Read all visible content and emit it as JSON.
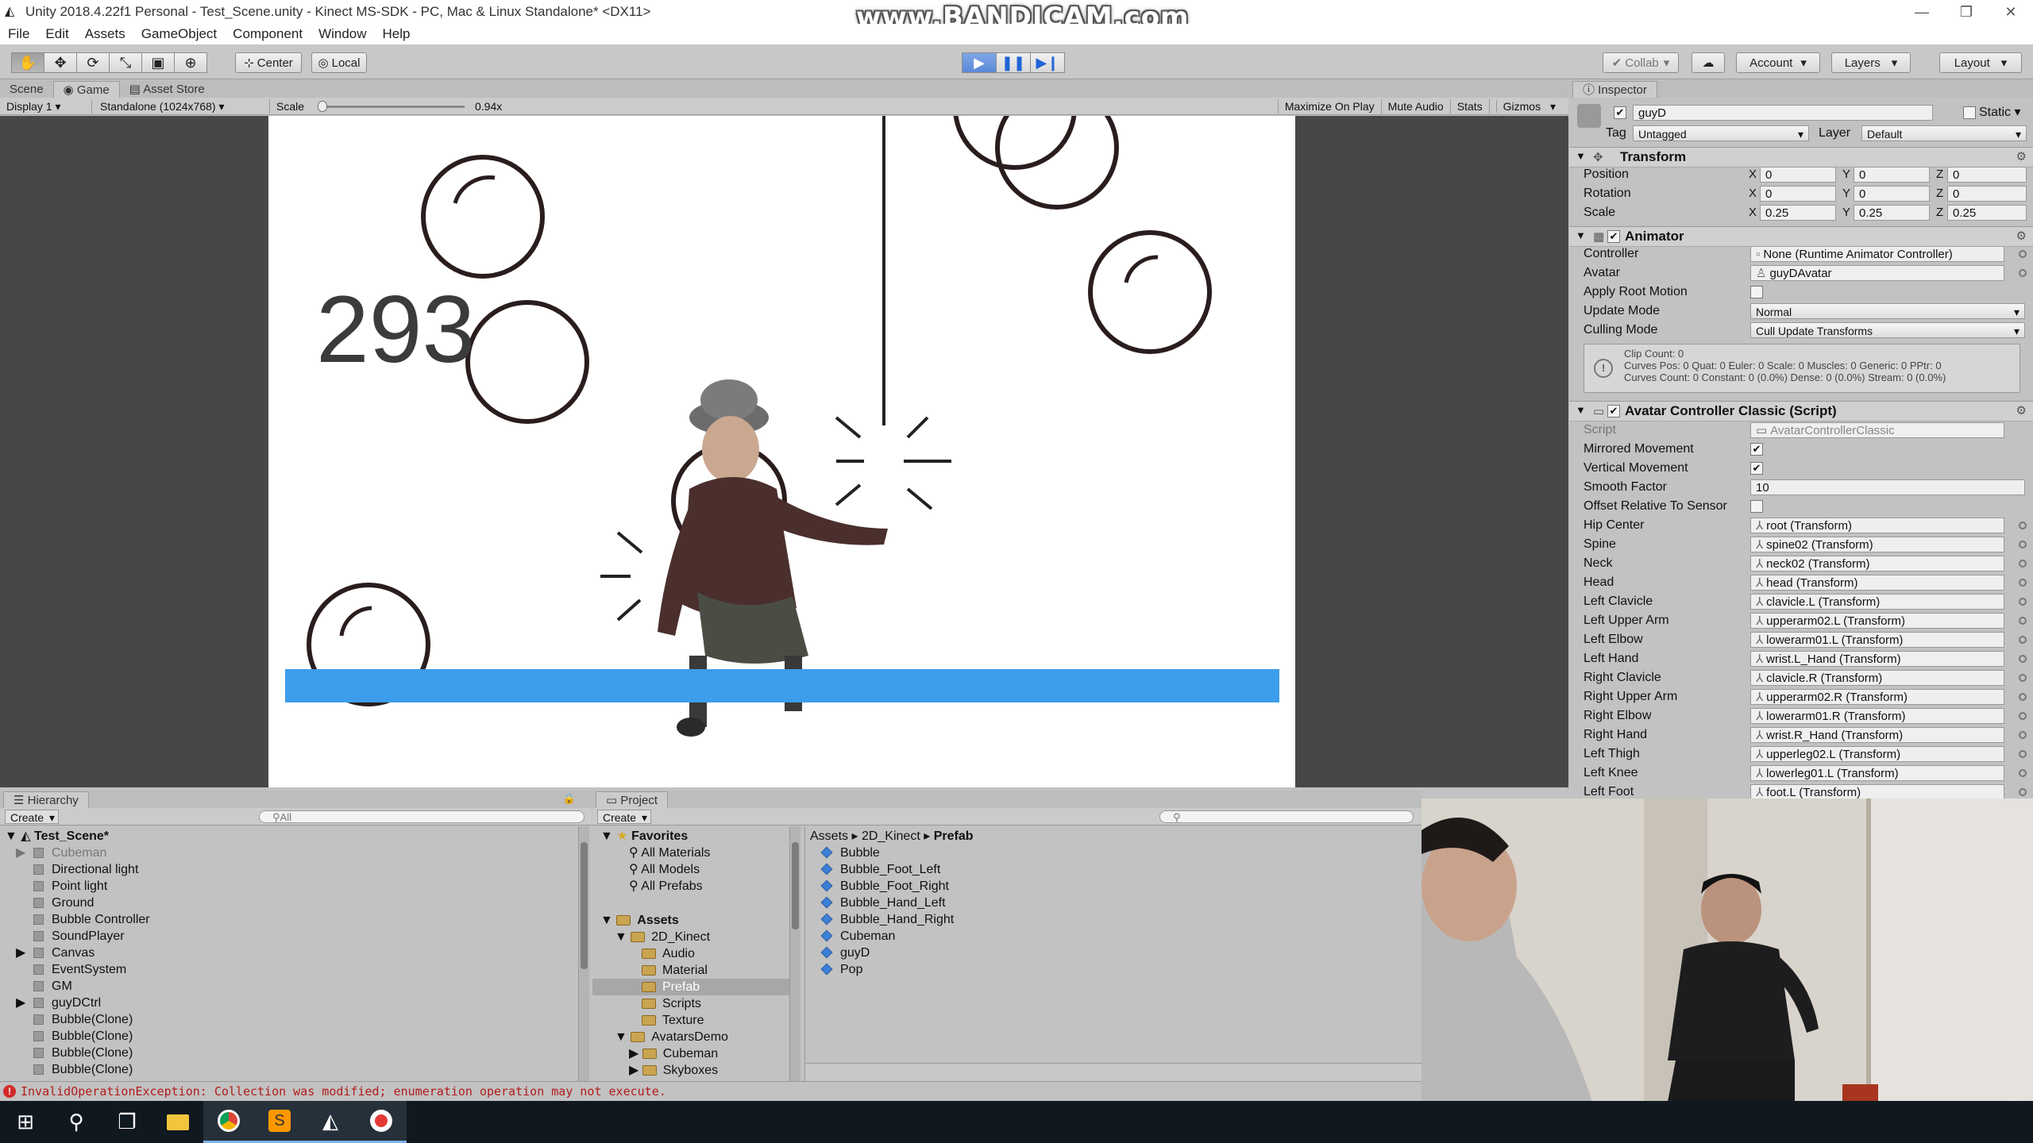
{
  "window": {
    "title": "Unity 2018.4.22f1 Personal - Test_Scene.unity - Kinect MS-SDK - PC, Mac & Linux Standalone* <DX11>",
    "watermark": "www.BANDICAM.com"
  },
  "menu": [
    "File",
    "Edit",
    "Assets",
    "GameObject",
    "Component",
    "Window",
    "Help"
  ],
  "toolbar": {
    "pivot": "Center",
    "space": "Local",
    "collab": "Collab",
    "account": "Account",
    "layers": "Layers",
    "layout": "Layout"
  },
  "game_view": {
    "tabs": [
      "Scene",
      "Game",
      "Asset Store"
    ],
    "display": "Display 1",
    "resolution": "Standalone (1024x768)",
    "scale_label": "Scale",
    "scale_value": "0.94",
    "options": [
      "Maximize On Play",
      "Mute Audio",
      "Stats",
      "Gizmos"
    ],
    "score": "293"
  },
  "inspector": {
    "tab": "Inspector",
    "object_name": "guyD",
    "static_label": "Static",
    "tag_label": "Tag",
    "tag_value": "Untagged",
    "layer_label": "Layer",
    "layer_value": "Default",
    "transform": {
      "title": "Transform",
      "position_label": "Position",
      "rotation_label": "Rotation",
      "scale_label": "Scale",
      "position": [
        "0",
        "0",
        "0"
      ],
      "rotation": [
        "0",
        "0",
        "0"
      ],
      "scale": [
        "0.25",
        "0.25",
        "0.25"
      ]
    },
    "animator": {
      "title": "Animator",
      "controller_label": "Controller",
      "controller_value": "None (Runtime Animator Controller)",
      "avatar_label": "Avatar",
      "avatar_value": "guyDAvatar",
      "apply_root_label": "Apply Root Motion",
      "update_mode_label": "Update Mode",
      "update_mode_value": "Normal",
      "culling_mode_label": "Culling Mode",
      "culling_mode_value": "Cull Update Transforms",
      "info_1": "Clip Count: 0",
      "info_2": "Curves Pos: 0 Quat: 0 Euler: 0 Scale: 0 Muscles: 0 Generic: 0 PPtr: 0",
      "info_3": "Curves Count: 0 Constant: 0 (0.0%) Dense: 0 (0.0%) Stream: 0 (0.0%)"
    },
    "avatar_controller": {
      "title": "Avatar Controller Classic (Script)",
      "script_label": "Script",
      "script_value": "AvatarControllerClassic",
      "mirrored_label": "Mirrored Movement",
      "vertical_label": "Vertical Movement",
      "smooth_label": "Smooth Factor",
      "smooth_value": "10",
      "offset_label": "Offset Relative To Sensor",
      "bones": [
        {
          "label": "Hip Center",
          "value": "root (Transform)"
        },
        {
          "label": "Spine",
          "value": "spine02 (Transform)"
        },
        {
          "label": "Neck",
          "value": "neck02 (Transform)"
        },
        {
          "label": "Head",
          "value": "head (Transform)"
        },
        {
          "label": "Left Clavicle",
          "value": "clavicle.L (Transform)"
        },
        {
          "label": "Left Upper Arm",
          "value": "upperarm02.L (Transform)"
        },
        {
          "label": "Left Elbow",
          "value": "lowerarm01.L (Transform)"
        },
        {
          "label": "Left Hand",
          "value": "wrist.L_Hand (Transform)"
        },
        {
          "label": "Right Clavicle",
          "value": "clavicle.R (Transform)"
        },
        {
          "label": "Right Upper Arm",
          "value": "upperarm02.R (Transform)"
        },
        {
          "label": "Right Elbow",
          "value": "lowerarm01.R (Transform)"
        },
        {
          "label": "Right Hand",
          "value": "wrist.R_Hand (Transform)"
        },
        {
          "label": "Left Thigh",
          "value": "upperleg02.L (Transform)"
        },
        {
          "label": "Left Knee",
          "value": "lowerleg01.L (Transform)"
        },
        {
          "label": "Left Foot",
          "value": "foot.L (Transform)"
        }
      ]
    }
  },
  "hierarchy": {
    "tab": "Hierarchy",
    "create": "Create",
    "search_placeholder": "All",
    "scene": "Test_Scene*",
    "items": [
      "Cubeman",
      "Directional light",
      "Point light",
      "Ground",
      "Bubble Controller",
      "SoundPlayer",
      "Canvas",
      "EventSystem",
      "GM",
      "guyDCtrl",
      "Bubble(Clone)",
      "Bubble(Clone)",
      "Bubble(Clone)",
      "Bubble(Clone)"
    ]
  },
  "project": {
    "tab": "Project",
    "create": "Create",
    "favorites_label": "Favorites",
    "favorites": [
      "All Materials",
      "All Models",
      "All Prefabs"
    ],
    "assets_label": "Assets",
    "tree": [
      "2D_Kinect",
      "Audio",
      "Material",
      "Prefab",
      "Scripts",
      "Texture",
      "AvatarsDemo",
      "Cubeman",
      "Skyboxes"
    ],
    "breadcrumb": [
      "Assets",
      "2D_Kinect",
      "Prefab"
    ],
    "files": [
      "Bubble",
      "Bubble_Foot_Left",
      "Bubble_Foot_Right",
      "Bubble_Hand_Left",
      "Bubble_Hand_Right",
      "Cubeman",
      "guyD",
      "Pop"
    ]
  },
  "status": {
    "message": "InvalidOperationException: Collection was modified; enumeration operation may not execute."
  }
}
